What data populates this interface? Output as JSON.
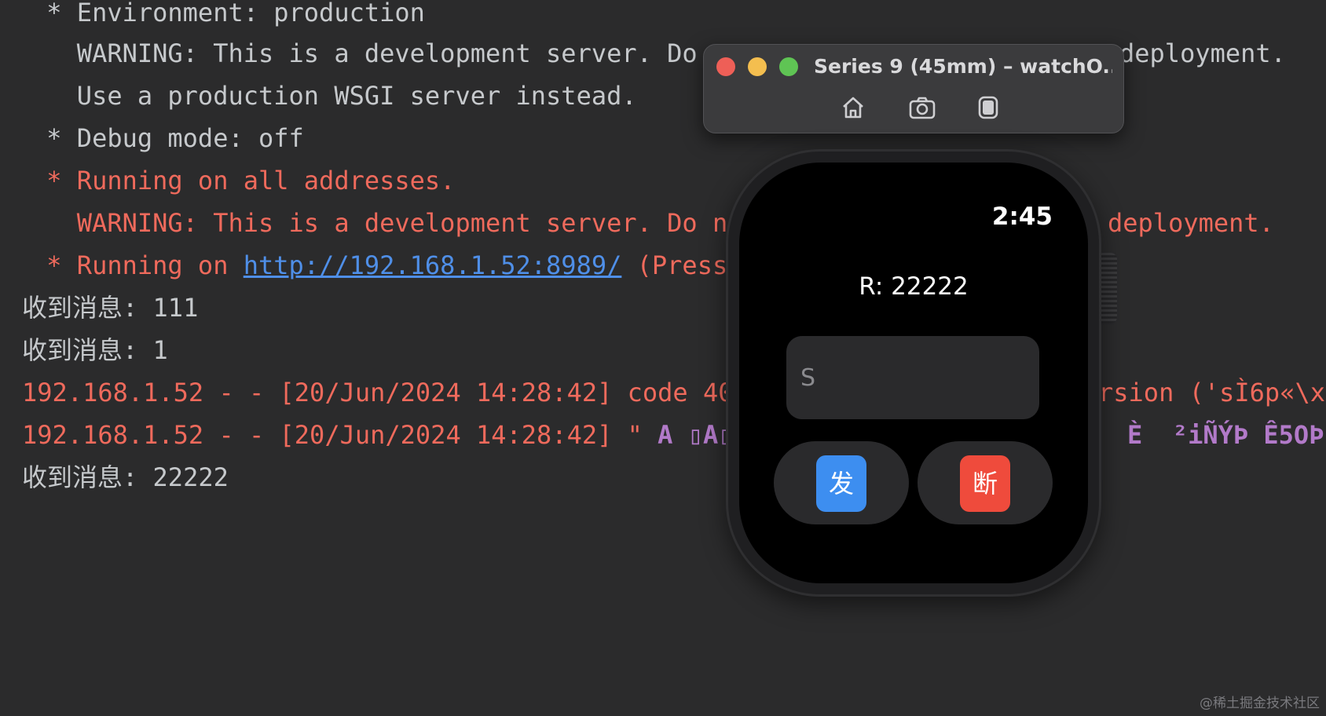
{
  "terminal": {
    "lines": {
      "env": " * Environment: production",
      "warn1": "   WARNING: This is a development server. Do n",
      "warn1_tail": "deployment.",
      "wsgi": "   Use a production WSGI server instead.",
      "debug": " * Debug mode: off",
      "running_all": " * Running on all addresses.",
      "warn2": "   WARNING: This is a development server. Do no",
      "warn2_tail": "deployment.",
      "running_prefix": " * Running on ",
      "running_url": "http://192.168.1.52:8989/",
      "running_suffix": " (Press",
      "msg1": "收到消息: 111",
      "msg2": "收到消息: 1",
      "log1": "192.168.1.52 - - [20/Jun/2024 14:28:42] code 40",
      "log1_tail": "rsion ('sÌ6p«\\x",
      "log2_prefix": "192.168.1.52 - - [20/Jun/2024 14:28:42] \" ",
      "log2_garbled": "A ▯A▯",
      "log2_tail": "È  ²iÑÝÞ Ê5OÞ",
      "msg3": "收到消息: 22222"
    }
  },
  "simulator": {
    "title": "Series 9 (45mm) – watchO...",
    "icons": {
      "home": "home-icon",
      "screenshot": "camera-icon",
      "rotate": "device-rotate-icon"
    }
  },
  "watch": {
    "time": "2:45",
    "received": "R: 22222",
    "input_placeholder": "S",
    "send_label": "发",
    "disconnect_label": "断",
    "colors": {
      "send": "#3d8ef0",
      "disconnect": "#ef4b3c"
    }
  },
  "watermark": "@稀土掘金技术社区"
}
